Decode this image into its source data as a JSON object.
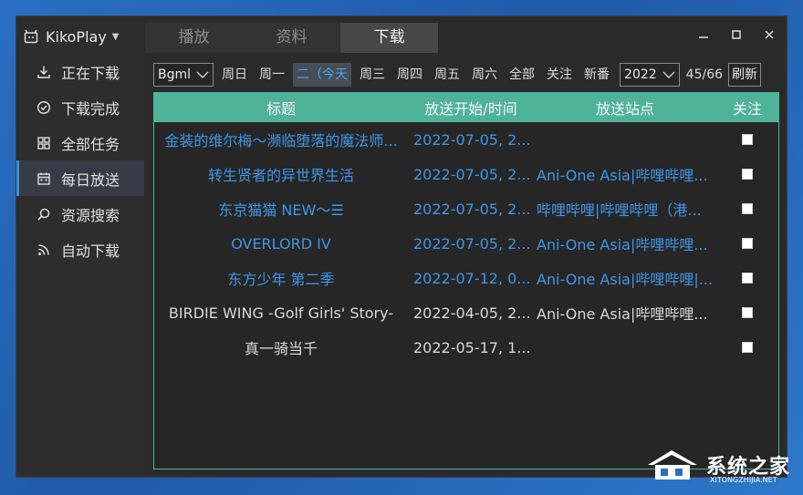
{
  "app": {
    "title": "KikoPlay"
  },
  "sidebar": {
    "items": [
      {
        "label": "正在下载",
        "icon": "download-icon"
      },
      {
        "label": "下载完成",
        "icon": "check-circle-icon"
      },
      {
        "label": "全部任务",
        "icon": "grid-icon"
      },
      {
        "label": "每日放送",
        "icon": "calendar-icon",
        "active": true
      },
      {
        "label": "资源搜索",
        "icon": "search-icon"
      },
      {
        "label": "自动下载",
        "icon": "rss-icon"
      }
    ]
  },
  "tabs": [
    {
      "label": "播放"
    },
    {
      "label": "资料"
    },
    {
      "label": "下载",
      "active": true
    }
  ],
  "toolbar": {
    "source": "Bgml",
    "days": [
      "周日",
      "周一",
      "二（今天",
      "周三",
      "周四",
      "周五",
      "周六",
      "全部",
      "关注",
      "新番"
    ],
    "today_index": 2,
    "year": "2022",
    "count": "45/66",
    "refresh_label": "刷新"
  },
  "table": {
    "headers": [
      "标题",
      "放送开始/时间",
      "放送站点",
      "关注"
    ],
    "rows": [
      {
        "title": "金装的维尔梅～濒临堕落的魔法师...",
        "time": "2022-07-05, 2...",
        "site": "",
        "favorite": true
      },
      {
        "title": "转生贤者的异世界生活",
        "time": "2022-07-05, 2...",
        "site": "Ani-One Asia|哔哩哔哩...",
        "favorite": true
      },
      {
        "title": "东京猫猫 NEW～☰",
        "time": "2022-07-05, 2...",
        "site": "哔哩哔哩|哔哩哔哩（港...",
        "favorite": true
      },
      {
        "title": "OVERLORD IV",
        "time": "2022-07-05, 2...",
        "site": "Ani-One Asia|哔哩哔哩...",
        "favorite": true
      },
      {
        "title": "东方少年 第二季",
        "time": "2022-07-12, 0...",
        "site": "Ani-One Asia|哔哩哔哩|...",
        "favorite": true
      },
      {
        "title": "BIRDIE WING -Golf Girls' Story-",
        "time": "2022-04-05, 2...",
        "site": "Ani-One Asia|哔哩哔哩...",
        "favorite": false
      },
      {
        "title": "真一骑当千",
        "time": "2022-05-17, 1...",
        "site": "",
        "favorite": false
      }
    ]
  },
  "watermark": {
    "text": "系统之家",
    "sub": "XITONGZHIJIA.NET"
  },
  "colors": {
    "accent": "#4fb39a",
    "link": "#3d96e6",
    "active_nav": "#3a8fe0"
  }
}
